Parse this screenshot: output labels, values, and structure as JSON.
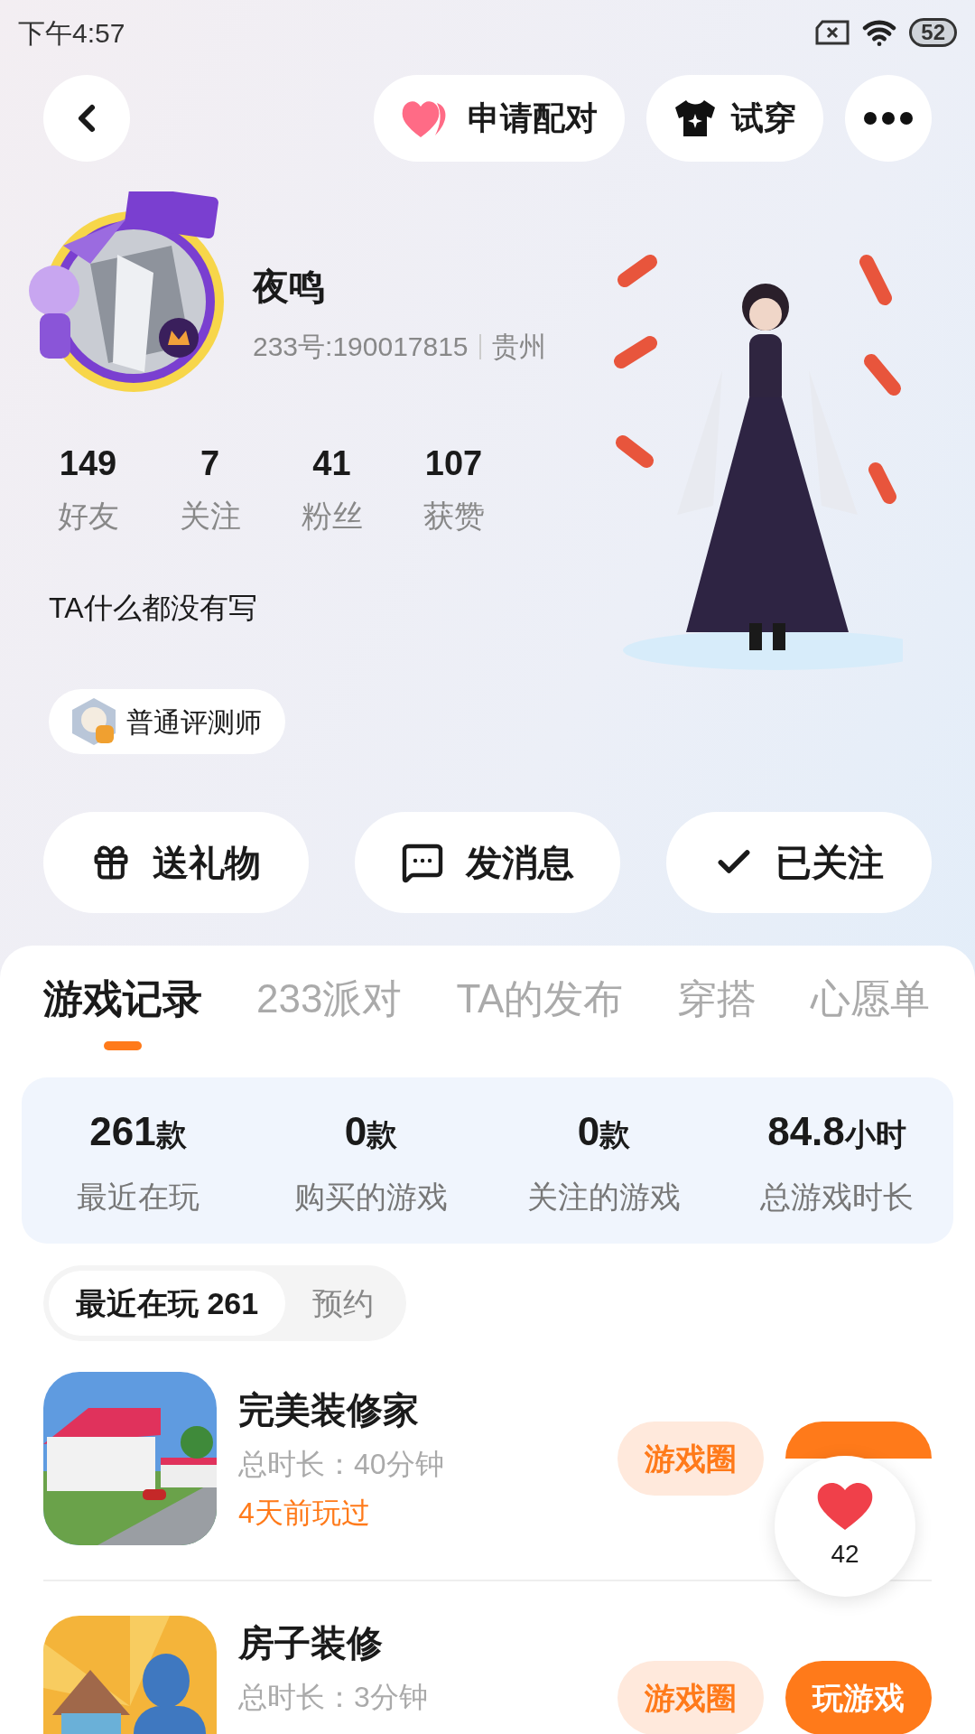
{
  "status_bar": {
    "time": "下午4:57",
    "battery": "52"
  },
  "top_actions": [
    {
      "kind": "pair",
      "label": "申请配对"
    },
    {
      "kind": "tryon",
      "label": "试穿"
    }
  ],
  "profile": {
    "name": "夜鸣",
    "id_line": "233号:190017815",
    "location": "贵州",
    "bio": "TA什么都没有写",
    "badge": "普通评测师"
  },
  "stats": [
    {
      "value": "149",
      "label": "好友"
    },
    {
      "value": "7",
      "label": "关注"
    },
    {
      "value": "41",
      "label": "粉丝"
    },
    {
      "value": "107",
      "label": "获赞"
    }
  ],
  "actions": [
    {
      "kind": "gift",
      "label": "送礼物"
    },
    {
      "kind": "message",
      "label": "发消息"
    },
    {
      "kind": "followed",
      "label": "已关注"
    }
  ],
  "tabs": [
    {
      "label": "游戏记录",
      "selected": true
    },
    {
      "label": "233派对",
      "selected": false
    },
    {
      "label": "TA的发布",
      "selected": false
    },
    {
      "label": "穿搭",
      "selected": false
    },
    {
      "label": "心愿单",
      "selected": false
    }
  ],
  "summary": [
    {
      "value": "261",
      "unit": "款",
      "label": "最近在玩"
    },
    {
      "value": "0",
      "unit": "款",
      "label": "购买的游戏"
    },
    {
      "value": "0",
      "unit": "款",
      "label": "关注的游戏"
    },
    {
      "value": "84.8",
      "unit": "小时",
      "label": "总游戏时长"
    }
  ],
  "segments": [
    {
      "label": "最近在玩 261",
      "selected": true
    },
    {
      "label": "预约",
      "selected": false
    }
  ],
  "games": [
    {
      "kind": "house",
      "title": "完美装修家",
      "duration": "总时长：40分钟",
      "last_played": "4天前玩过",
      "circle": "游戏圈"
    },
    {
      "kind": "cartoon",
      "title": "房子装修",
      "duration": "总时长：3分钟",
      "circle": "游戏圈",
      "play": "玩游戏"
    }
  ],
  "floating_like": {
    "count": "42"
  }
}
